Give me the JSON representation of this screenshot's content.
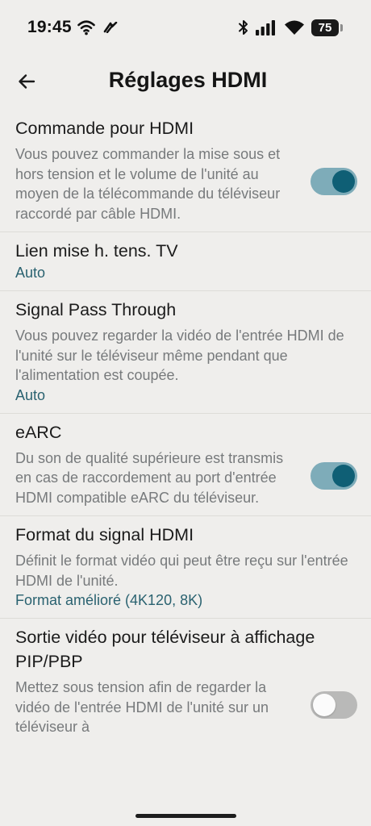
{
  "status_bar": {
    "time": "19:45",
    "battery": "75",
    "icons": [
      "wifi-icon",
      "data-saver-icon",
      "bluetooth-icon",
      "signal-icon",
      "wifi-icon",
      "battery-icon"
    ]
  },
  "header": {
    "back_icon": "arrow-left-icon",
    "title": "Réglages HDMI"
  },
  "items": [
    {
      "title": "Commande pour HDMI",
      "description": "Vous pouvez commander la mise sous et hors tension et le volume de l'unité au moyen de la télécommande du téléviseur raccordé par câble HDMI.",
      "toggle": "on"
    },
    {
      "title": "Lien mise h. tens. TV",
      "value": "Auto"
    },
    {
      "title": "Signal Pass Through",
      "description": "Vous pouvez regarder la vidéo de l'entrée HDMI de l'unité sur le téléviseur même pendant que l'alimentation est coupée.",
      "value": "Auto"
    },
    {
      "title": "eARC",
      "description": "Du son de qualité supérieure est transmis en cas de raccordement au port d'entrée HDMI compatible eARC du téléviseur.",
      "toggle": "on"
    },
    {
      "title": "Format du signal HDMI",
      "description": "Définit le format vidéo qui peut être reçu sur l'entrée HDMI de l'unité.",
      "value": "Format amélioré (4K120, 8K)"
    },
    {
      "title": "Sortie vidéo pour téléviseur à affichage PIP/PBP",
      "description": "Mettez sous tension afin de regarder la vidéo de l'entrée HDMI de l'unité sur un téléviseur à",
      "toggle": "off"
    }
  ],
  "colors": {
    "background": "#efeeec",
    "accent": "#0f5f75",
    "toggle_track_on": "#7eacb9",
    "value_text": "#2a6270",
    "secondary_text": "#777a7c"
  }
}
